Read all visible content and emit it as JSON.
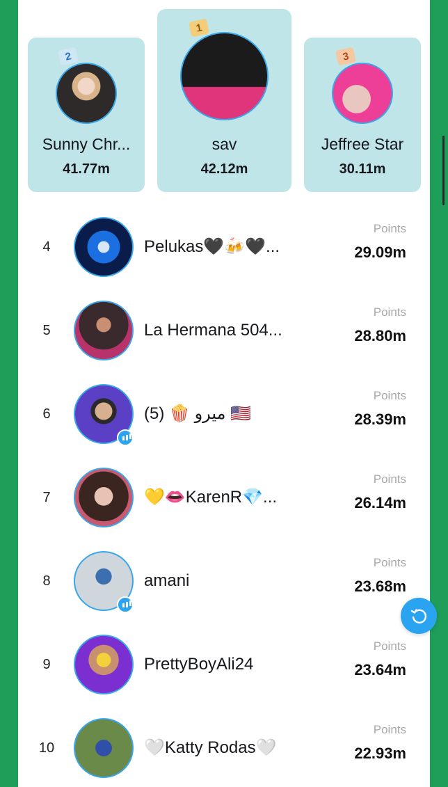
{
  "podium": [
    {
      "rank": "2",
      "name": "Sunny Chr...",
      "score": "41.77m"
    },
    {
      "rank": "1",
      "name": "sav",
      "score": "42.12m"
    },
    {
      "rank": "3",
      "name": "Jeffree Star",
      "score": "30.11m"
    }
  ],
  "points_label": "Points",
  "list": [
    {
      "rank": "4",
      "name": "Pelukas🖤🍻🖤...",
      "score": "29.09m"
    },
    {
      "rank": "5",
      "name": "La Hermana 504...",
      "score": "28.80m"
    },
    {
      "rank": "6",
      "name": "(5) 🍿 ميرو 🇺🇸",
      "score": "28.39m"
    },
    {
      "rank": "7",
      "name": "💛👄KarenR💎...",
      "score": "26.14m"
    },
    {
      "rank": "8",
      "name": "amani",
      "score": "23.68m"
    },
    {
      "rank": "9",
      "name": "PrettyBoyAli24",
      "score": "23.64m"
    },
    {
      "rank": "10",
      "name": "🤍Katty Rodas🤍",
      "score": "22.93m"
    }
  ],
  "colors": {
    "accent": "#2aa3f0",
    "podium_bg": "#bfe5e8",
    "frame": "#1f9e5a"
  },
  "icons": {
    "refresh": "refresh-icon",
    "stats": "stats-badge-icon",
    "crown": "crown-icon"
  }
}
